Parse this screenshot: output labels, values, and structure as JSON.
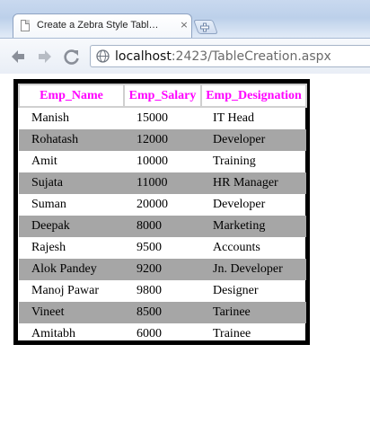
{
  "browser": {
    "tab_title": "Create a Zebra Style Tabl…",
    "tab_close": "×",
    "url_host": "localhost",
    "url_rest": ":2423/TableCreation.aspx"
  },
  "grid": {
    "headers": [
      "Emp_Name",
      "Emp_Salary",
      "Emp_Designation"
    ],
    "rows": [
      {
        "name": "Manish",
        "salary": "15000",
        "designation": "IT Head"
      },
      {
        "name": "Rohatash",
        "salary": "12000",
        "designation": "Developer"
      },
      {
        "name": "Amit",
        "salary": "10000",
        "designation": "Training"
      },
      {
        "name": "Sujata",
        "salary": "11000",
        "designation": "HR Manager"
      },
      {
        "name": "Suman",
        "salary": "20000",
        "designation": "Developer"
      },
      {
        "name": "Deepak",
        "salary": "8000",
        "designation": "Marketing"
      },
      {
        "name": "Rajesh",
        "salary": "9500",
        "designation": "Accounts"
      },
      {
        "name": "Alok Pandey",
        "salary": "9200",
        "designation": "Jn. Developer"
      },
      {
        "name": "Manoj Pawar",
        "salary": "9800",
        "designation": "Designer"
      },
      {
        "name": "Vineet",
        "salary": "8500",
        "designation": "Tarinee"
      },
      {
        "name": "Amitabh",
        "salary": "6000",
        "designation": "Trainee"
      }
    ]
  },
  "colors": {
    "header_text": "#ff00ff",
    "alt_row": "#a6a6a6",
    "grid_border": "#000000"
  }
}
